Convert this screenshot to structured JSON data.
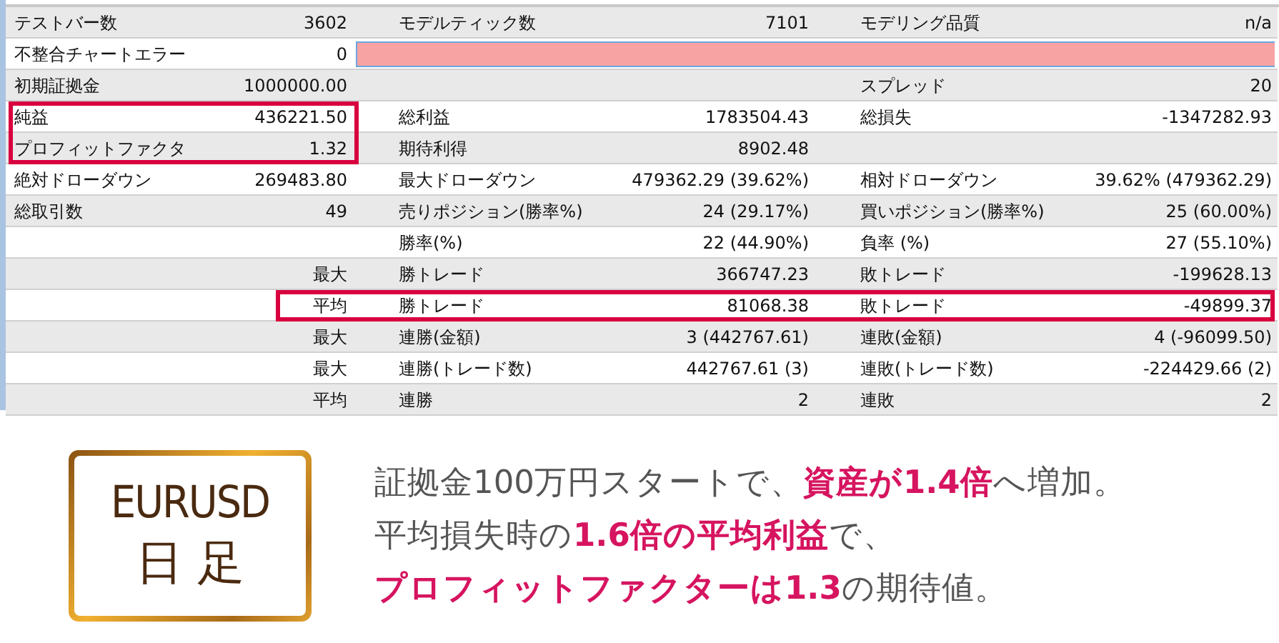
{
  "report": {
    "rows": [
      {
        "label1": "テストバー数",
        "value1": "3602",
        "label2": "モデルティック数",
        "value2": "7101",
        "label3": "モデリング品質",
        "value3": "n/a"
      },
      {
        "label1": "不整合チャートエラー",
        "value1": "0",
        "error_bar": true
      },
      {
        "label1": "初期証拠金",
        "value1": "1000000.00",
        "label3": "スプレッド",
        "value3": "20"
      },
      {
        "label1": "純益",
        "value1": "436221.50",
        "label2": "総利益",
        "value2": "1783504.43",
        "label3": "総損失",
        "value3": "-1347282.93",
        "frame_left": true
      },
      {
        "label1": "プロフィットファクタ",
        "value1": "1.32",
        "label2": "期待利得",
        "value2": "8902.48",
        "frame_left": true
      },
      {
        "label1": "絶対ドローダウン",
        "value1": "269483.80",
        "label2": "最大ドローダウン",
        "value2": "479362.29 (39.62%)",
        "label3": "相対ドローダウン",
        "value3": "39.62% (479362.29)"
      },
      {
        "label1": "総取引数",
        "value1": "49",
        "label2": "売りポジション(勝率%)",
        "value2": "24 (29.17%)",
        "label3": "買いポジション(勝率%)",
        "value3": "25 (60.00%)"
      },
      {
        "label2": "勝率(%)",
        "value2": "22 (44.90%)",
        "label3": "負率 (%)",
        "value3": "27 (55.10%)"
      },
      {
        "value1": "最大",
        "label2": "勝トレード",
        "value2": "366747.23",
        "label3": "敗トレード",
        "value3": "-199628.13"
      },
      {
        "value1": "平均",
        "label2": "勝トレード",
        "value2": "81068.38",
        "label3": "敗トレード",
        "value3": "-49899.37",
        "frame_right": true
      },
      {
        "value1": "最大",
        "label2": "連勝(金額)",
        "value2": "3 (442767.61)",
        "label3": "連敗(金額)",
        "value3": "4 (-96099.50)"
      },
      {
        "value1": "最大",
        "label2": "連勝(トレード数)",
        "value2": "442767.61 (3)",
        "label3": "連敗(トレード数)",
        "value3": "-224429.66 (2)"
      },
      {
        "value1": "平均",
        "label2": "連勝",
        "value2": "2",
        "label3": "連敗",
        "value3": "2"
      }
    ]
  },
  "caption": {
    "badge_line1": "EURUSD",
    "badge_line2": "日 足",
    "lines": [
      "証拠金100万円スタートで、**資産が1.4倍**へ増加。",
      "平均損失時の**1.6倍の平均利益**で、",
      "**プロフィットファクターは1.3**の期待値。"
    ]
  }
}
